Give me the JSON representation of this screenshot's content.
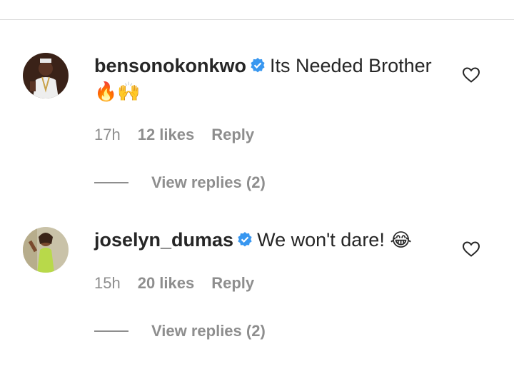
{
  "comments": [
    {
      "avatar": "avatar-man-white-outfit",
      "username": "bensonokonkwo",
      "verified": true,
      "text": "Its Needed Brother",
      "emojis": "🔥🙌",
      "time": "17h",
      "likes": "12 likes",
      "reply_label": "Reply",
      "view_replies": "View replies (2)",
      "liked": false
    },
    {
      "avatar": "avatar-woman-green-dress",
      "username": "joselyn_dumas",
      "verified": true,
      "text": "We won't dare!",
      "emojis": "😂",
      "time": "15h",
      "likes": "20 likes",
      "reply_label": "Reply",
      "view_replies": "View replies (2)",
      "liked": false
    }
  ],
  "colors": {
    "verified_badge": "#3897f0",
    "secondary_text": "#8e8e8e",
    "primary_text": "#262626"
  }
}
